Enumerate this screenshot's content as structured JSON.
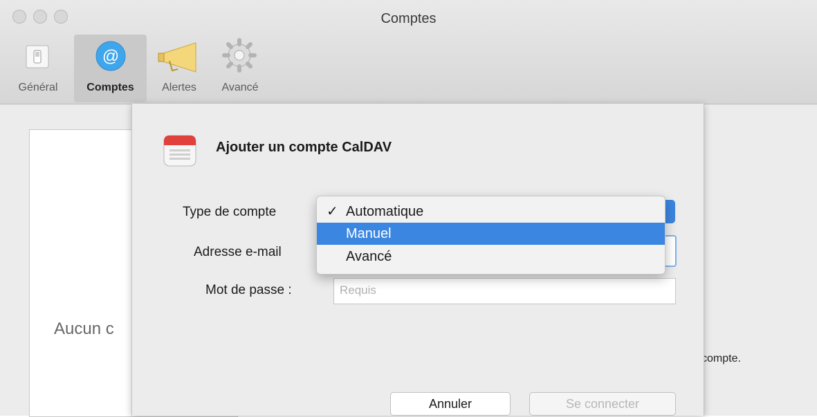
{
  "window": {
    "title": "Comptes"
  },
  "toolbar": {
    "items": [
      {
        "label": "Général",
        "icon": "switch-icon"
      },
      {
        "label": "Comptes",
        "icon": "at-sign-icon"
      },
      {
        "label": "Alertes",
        "icon": "megaphone-icon"
      },
      {
        "label": "Avancé",
        "icon": "gear-icon"
      }
    ],
    "selected": "Comptes"
  },
  "main": {
    "empty_text": "Aucun c",
    "hint_text": "compte."
  },
  "sheet": {
    "title": "Ajouter un compte CalDAV",
    "fields": {
      "account_type_label": "Type de compte",
      "email_label": "Adresse e-mail",
      "password_label": "Mot de passe :",
      "password_placeholder": "Requis"
    },
    "menu": {
      "check": "✓",
      "options": [
        "Automatique",
        "Manuel",
        "Avancé"
      ],
      "selected": "Automatique",
      "highlighted": "Manuel"
    },
    "buttons": {
      "cancel": "Annuler",
      "connect": "Se connecter"
    }
  },
  "colors": {
    "accent": "#3b86e0",
    "window_bg": "#ececec"
  }
}
